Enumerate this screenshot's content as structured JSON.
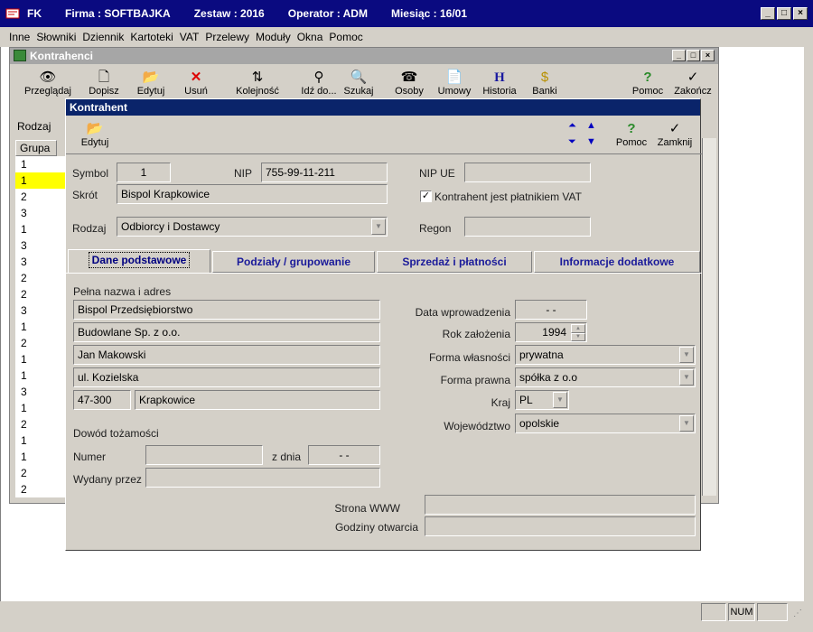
{
  "app": {
    "name": "FK",
    "firma": "Firma : SOFTBAJKA",
    "zestaw": "Zestaw : 2016",
    "operator": "Operator : ADM",
    "miesiac": "Miesiąc : 16/01"
  },
  "menu": [
    "Inne",
    "Słowniki",
    "Dziennik",
    "Kartoteki",
    "VAT",
    "Przelewy",
    "Moduły",
    "Okna",
    "Pomoc"
  ],
  "child": {
    "title": "Kontrahenci",
    "toolbar": {
      "przegladaj": "Przeglądaj",
      "dopisz": "Dopisz",
      "edytuj": "Edytuj",
      "usun": "Usuń",
      "kolejnosc": "Kolejność",
      "idz": "Idź do...",
      "szukaj": "Szukaj",
      "osoby": "Osoby",
      "umowy": "Umowy",
      "historia": "Historia",
      "banki": "Banki",
      "pomoc": "Pomoc",
      "zakoncz": "Zakończ"
    },
    "rodzaj_label": "Rodzaj",
    "grid_header": "Grupa",
    "grid_rows": [
      "1",
      "1",
      "2",
      "3",
      "1",
      "3",
      "3",
      "2",
      "2",
      "3",
      "1",
      "2",
      "1",
      "1",
      "3",
      "1",
      "2",
      "1",
      "1",
      "2",
      "2"
    ]
  },
  "dialog": {
    "title": "Kontrahent",
    "edytuj": "Edytuj",
    "pomoc": "Pomoc",
    "zamknij": "Zamknij",
    "symbol_label": "Symbol",
    "symbol": "1",
    "nip_label": "NIP",
    "nip": "755-99-11-211",
    "nipue_label": "NIP UE",
    "nipue": "",
    "skrot_label": "Skrót",
    "skrot": "Bispol Krapkowice",
    "vat_label": "Kontrahent jest płatnikiem VAT",
    "rodzaj_label": "Rodzaj",
    "rodzaj": "Odbiorcy i Dostawcy",
    "regon_label": "Regon",
    "regon": "",
    "tabs": [
      "Dane podstawowe",
      "Podziały / grupowanie",
      "Sprzedaż i płatności",
      "Informacje dodatkowe"
    ],
    "pelna_label": "Pełna nazwa i adres",
    "addr1": "Bispol  Przedsiębiorstwo",
    "addr2": "Budowlane Sp. z o.o.",
    "addr3": "Jan Makowski",
    "addr4": "ul. Kozielska",
    "kod": "47-300",
    "miasto": "Krapkowice",
    "dowod_label": "Dowód tożamości",
    "numer_label": "Numer",
    "numer": "",
    "zdnia_label": "z dnia",
    "zdnia": "- -",
    "wydany_label": "Wydany przez",
    "wydany": "",
    "data_wpr_label": "Data wprowadzenia",
    "data_wpr": "- -",
    "rok_label": "Rok założenia",
    "rok": "1994",
    "forma_wl_label": "Forma własności",
    "forma_wl": "prywatna",
    "forma_pr_label": "Forma prawna",
    "forma_pr": "spółka z o.o",
    "kraj_label": "Kraj",
    "kraj": "PL",
    "woj_label": "Województwo",
    "woj": "opolskie",
    "www_label": "Strona WWW",
    "www": "",
    "godziny_label": "Godziny otwarcia",
    "godziny": ""
  },
  "status": {
    "num": "NUM"
  }
}
